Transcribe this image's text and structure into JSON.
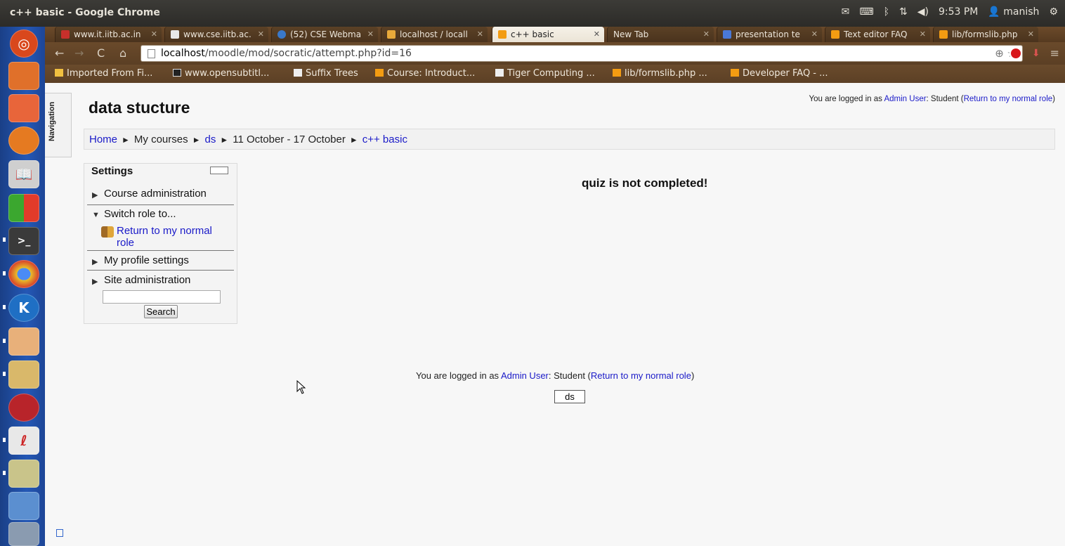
{
  "window": {
    "title": "c++ basic - Google Chrome"
  },
  "tray": {
    "time": "9:53 PM",
    "user": "manish"
  },
  "tabs": [
    {
      "label": "www.it.iitb.ac.in",
      "favicon_color": "#c8302b"
    },
    {
      "label": "www.cse.iitb.ac.",
      "favicon_color": "#dddddd"
    },
    {
      "label": "(52) CSE Webma",
      "favicon_color": "#3a78c8"
    },
    {
      "label": "localhost / locall",
      "favicon_color": "#e8a93a"
    },
    {
      "label": "c++ basic",
      "favicon_color": "#f39c12",
      "active": true
    },
    {
      "label": "New Tab",
      "favicon_color": ""
    },
    {
      "label": "presentation te",
      "favicon_color": "#4a79d8"
    },
    {
      "label": "Text editor FAQ",
      "favicon_color": "#f39c12"
    },
    {
      "label": "lib/formslib.php",
      "favicon_color": "#f39c12"
    }
  ],
  "address": {
    "host": "localhost",
    "path": "/moodle/mod/socratic/attempt.php?id=16"
  },
  "bookmarks": [
    "Imported From Fi...",
    "www.opensubtitl...",
    "Suffix Trees",
    "Course: Introduct...",
    "Tiger Computing ...",
    "lib/formslib.php ...",
    "Developer FAQ - ..."
  ],
  "page": {
    "nav_tab": "Navigation",
    "site_title": "data stucture",
    "login_top": {
      "prefix": "You are logged in as ",
      "user": "Admin User",
      "middle": ": Student (",
      "link": "Return to my normal role",
      "suffix": ")"
    },
    "breadcrumb": [
      "Home",
      "My courses",
      "ds",
      "11 October - 17 October",
      "c++ basic"
    ],
    "settings": {
      "header": "Settings",
      "items": [
        "Course administration",
        "Switch role to...",
        "My profile settings",
        "Site administration"
      ],
      "return_link": "Return to my normal role",
      "search_label": "Search"
    },
    "notice": "quiz is not completed!",
    "login_bottom": {
      "prefix": "You are logged in as ",
      "user": "Admin User",
      "middle": ": Student (",
      "link": "Return to my normal role",
      "suffix": ")"
    },
    "course_button": "ds"
  }
}
